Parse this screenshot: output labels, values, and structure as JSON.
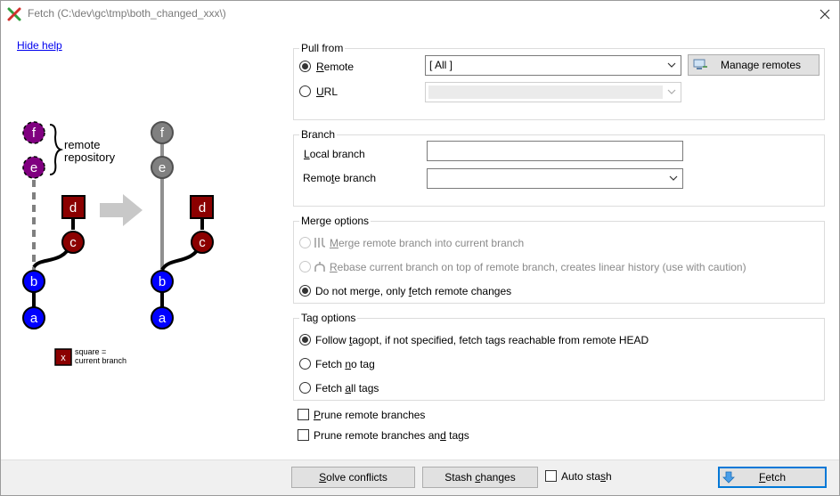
{
  "window": {
    "title": "Fetch (C:\\dev\\gc\\tmp\\both_changed_xxx\\)"
  },
  "help": {
    "hide_help_link": "Hide help",
    "diagram": {
      "remote_label_1": "remote",
      "remote_label_2": "repository",
      "legend_x": "x",
      "legend_1": "square =",
      "legend_2": "current branch",
      "left_commits": [
        "f",
        "e",
        "d",
        "c",
        "b",
        "a"
      ],
      "right_commits": [
        "f",
        "e",
        "d",
        "c",
        "b",
        "a"
      ]
    }
  },
  "pull_from": {
    "group_label": "Pull from",
    "remote_label": "Remote",
    "remote_accel": "R",
    "remote_rest": "emote",
    "url_label": "URL",
    "url_accel": "U",
    "url_rest": "RL",
    "remote_selected": "[ All ]",
    "manage_remotes_label": "Manage remotes",
    "selected_option": "remote"
  },
  "branch": {
    "group_label": "Branch",
    "local_branch_label": "Local branch",
    "local_accel": "L",
    "local_rest": "ocal branch",
    "remote_branch_label": "Remote branch",
    "remote_pre": "Remo",
    "remote_accel": "t",
    "remote_rest": "e branch",
    "local_branch_value": "",
    "remote_branch_value": ""
  },
  "merge_options": {
    "group_label": "Merge options",
    "merge_pre": "",
    "merge_accel": "M",
    "merge_rest": "erge remote branch into current branch",
    "rebase_pre": "",
    "rebase_accel": "R",
    "rebase_rest": "ebase current branch on top of remote branch, creates linear history (use with caution)",
    "nomerge_pre": "Do not merge, only ",
    "nomerge_accel": "f",
    "nomerge_rest": "etch remote changes",
    "selected_option": "do-not-merge"
  },
  "tag_options": {
    "group_label": "Tag options",
    "follow_pre": "Follow ",
    "follow_accel": "t",
    "follow_rest": "agopt, if not specified, fetch tags reachable from remote HEAD",
    "notag_pre": "Fetch ",
    "notag_accel": "n",
    "notag_rest": "o tag",
    "alltags_pre": "Fetch ",
    "alltags_accel": "a",
    "alltags_rest": "ll tags",
    "selected_option": "follow-tagopt"
  },
  "prune": {
    "prune_branches_pre": "",
    "prune_branches_accel": "P",
    "prune_branches_rest": "rune remote branches",
    "prune_tags_pre": "Prune remote branches an",
    "prune_tags_accel": "d",
    "prune_tags_rest": " tags",
    "prune_branches_checked": false,
    "prune_tags_checked": false
  },
  "footer": {
    "solve_pre": "",
    "solve_accel": "S",
    "solve_rest": "olve conflicts",
    "stash_pre": "Stash ",
    "stash_accel": "c",
    "stash_rest": "hanges",
    "auto_stash_pre": "Auto sta",
    "auto_stash_accel": "s",
    "auto_stash_rest": "h",
    "auto_stash_checked": false,
    "fetch_pre": "",
    "fetch_accel": "F",
    "fetch_rest": "etch"
  },
  "colors": {
    "accent": "#0078d7",
    "commit_purple": "#800080",
    "commit_red": "#8b0000",
    "commit_blue": "#0000ff",
    "commit_gray": "#808080"
  }
}
